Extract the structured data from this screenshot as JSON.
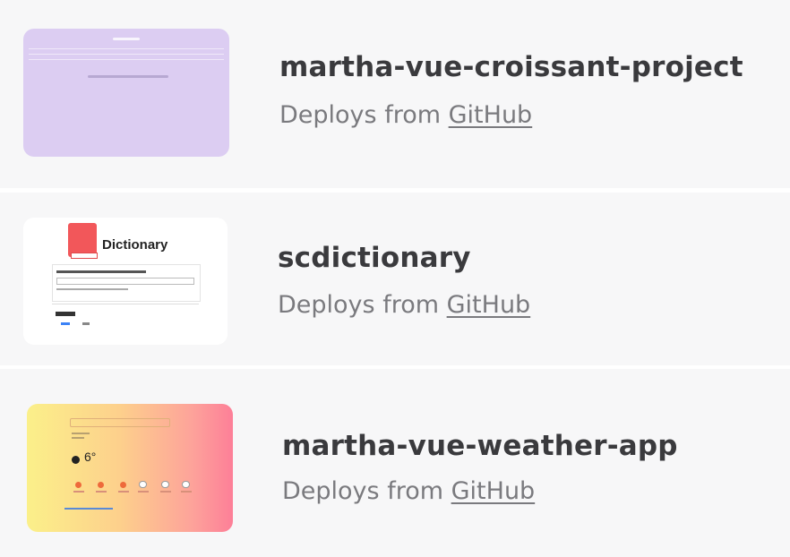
{
  "sites": [
    {
      "name": "martha-vue-croissant-project",
      "deploy_prefix": "Deploys from",
      "deploy_source": "GitHub"
    },
    {
      "name": "scdictionary",
      "deploy_prefix": "Deploys from",
      "deploy_source": "GitHub",
      "thumbnail": {
        "title": "Dictionary"
      }
    },
    {
      "name": "martha-vue-weather-app",
      "deploy_prefix": "Deploys from",
      "deploy_source": "GitHub",
      "thumbnail": {
        "temperature": "6°"
      }
    }
  ],
  "colors": {
    "row_background": "#f7f7f8",
    "title_text": "#3a3a3d",
    "secondary_text": "#7a7a7e",
    "croissant_thumb": "#dccdf2",
    "weather_gradient_start": "#fbf08a",
    "weather_gradient_end": "#fd7f98",
    "dictionary_book": "#f2575a"
  }
}
